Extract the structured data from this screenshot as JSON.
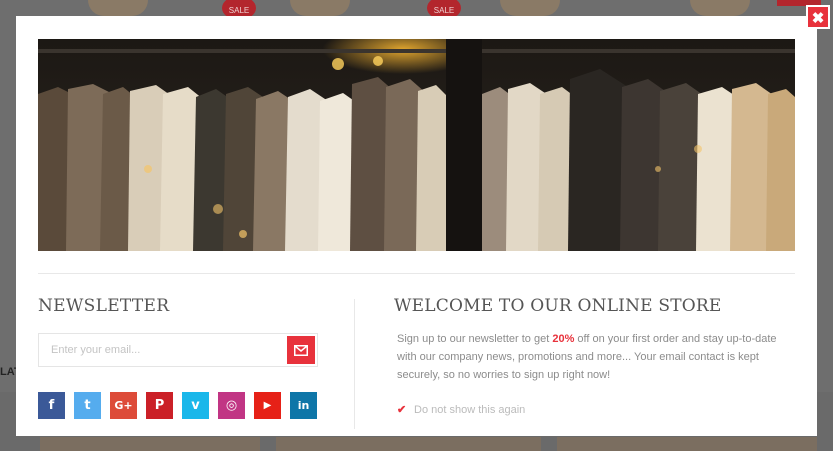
{
  "background": {
    "sale_badges": [
      "SALE",
      "SALE"
    ],
    "partial_label": "LAT"
  },
  "modal": {
    "close_label": "✖",
    "newsletter": {
      "title": "NEWSLETTER",
      "email_placeholder": "Enter your email...",
      "email_value": "",
      "send_icon": "envelope-icon"
    },
    "socials": [
      {
        "name": "facebook",
        "glyph": "f",
        "color": "#3b5998"
      },
      {
        "name": "twitter",
        "glyph": "t",
        "color": "#55acee"
      },
      {
        "name": "google-plus",
        "glyph": "G+",
        "color": "#dd4b39"
      },
      {
        "name": "pinterest",
        "glyph": "P",
        "color": "#cb2027"
      },
      {
        "name": "vimeo",
        "glyph": "v",
        "color": "#1ab7ea"
      },
      {
        "name": "instagram",
        "glyph": "◎",
        "color": "#c13584"
      },
      {
        "name": "youtube",
        "glyph": "▶",
        "color": "#e62117"
      },
      {
        "name": "linkedin",
        "glyph": "in",
        "color": "#0e76a8"
      }
    ],
    "welcome": {
      "title": "WELCOME TO OUR ONLINE STORE",
      "desc_before": "Sign up to our newsletter to get ",
      "desc_highlight": "20%",
      "desc_after": " off on your first order  and stay up-to-date with our company news, promotions and more... Your email contact is kept securely, so no worries to sign up right now!",
      "dont_show_label": "Do not show this again",
      "dont_show_checked": true
    },
    "accent_color": "#e8323c"
  }
}
